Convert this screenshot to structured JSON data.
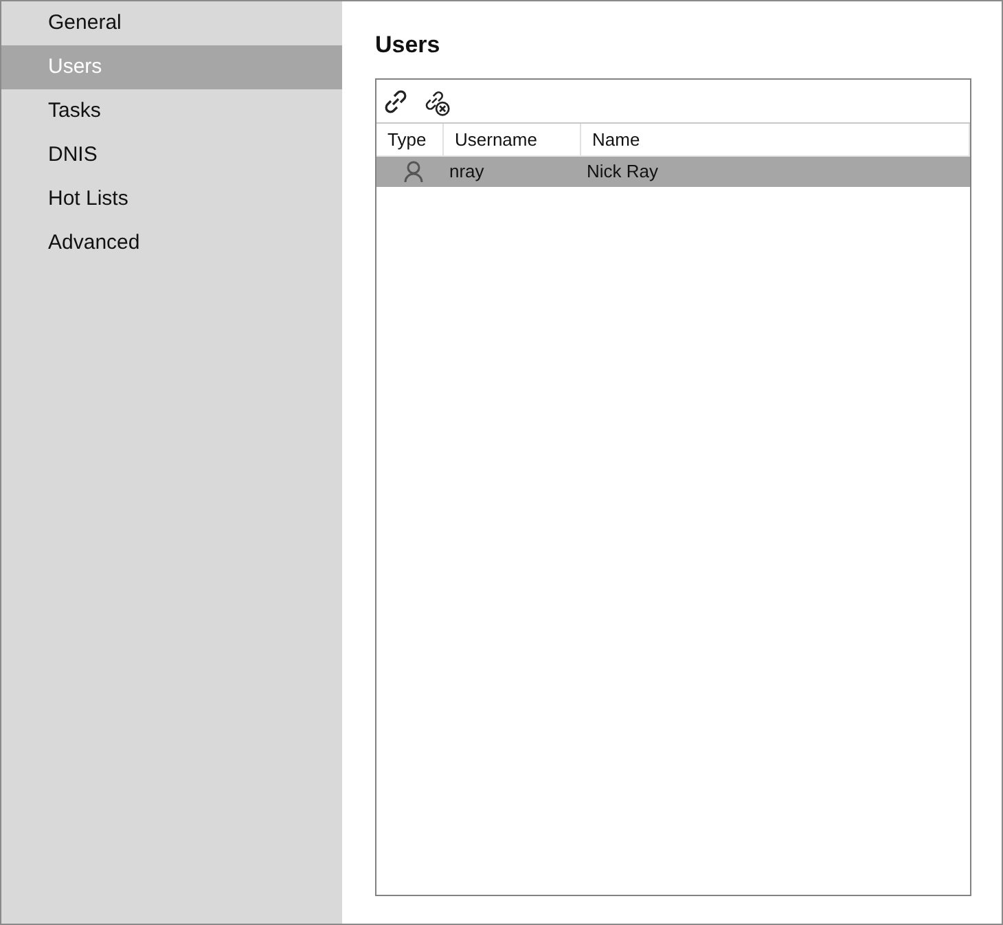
{
  "sidebar": {
    "items": [
      {
        "label": "General",
        "selected": false
      },
      {
        "label": "Users",
        "selected": true
      },
      {
        "label": "Tasks",
        "selected": false
      },
      {
        "label": "DNIS",
        "selected": false
      },
      {
        "label": "Hot Lists",
        "selected": false
      },
      {
        "label": "Advanced",
        "selected": false
      }
    ]
  },
  "page_title": "Users",
  "table": {
    "columns": [
      "Type",
      "Username",
      "Name"
    ],
    "rows": [
      {
        "kind": "user",
        "username": "nray",
        "name": "Nick Ray",
        "selected": true
      }
    ]
  }
}
